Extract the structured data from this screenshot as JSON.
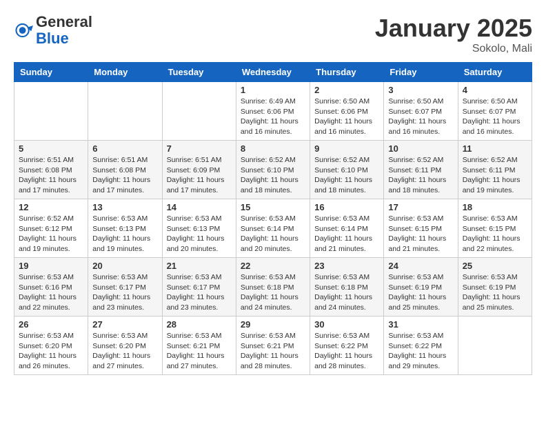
{
  "header": {
    "logo_general": "General",
    "logo_blue": "Blue",
    "month": "January 2025",
    "location": "Sokolo, Mali"
  },
  "days_of_week": [
    "Sunday",
    "Monday",
    "Tuesday",
    "Wednesday",
    "Thursday",
    "Friday",
    "Saturday"
  ],
  "weeks": [
    [
      {
        "day": "",
        "info": ""
      },
      {
        "day": "",
        "info": ""
      },
      {
        "day": "",
        "info": ""
      },
      {
        "day": "1",
        "info": "Sunrise: 6:49 AM\nSunset: 6:06 PM\nDaylight: 11 hours and 16 minutes."
      },
      {
        "day": "2",
        "info": "Sunrise: 6:50 AM\nSunset: 6:06 PM\nDaylight: 11 hours and 16 minutes."
      },
      {
        "day": "3",
        "info": "Sunrise: 6:50 AM\nSunset: 6:07 PM\nDaylight: 11 hours and 16 minutes."
      },
      {
        "day": "4",
        "info": "Sunrise: 6:50 AM\nSunset: 6:07 PM\nDaylight: 11 hours and 16 minutes."
      }
    ],
    [
      {
        "day": "5",
        "info": "Sunrise: 6:51 AM\nSunset: 6:08 PM\nDaylight: 11 hours and 17 minutes."
      },
      {
        "day": "6",
        "info": "Sunrise: 6:51 AM\nSunset: 6:08 PM\nDaylight: 11 hours and 17 minutes."
      },
      {
        "day": "7",
        "info": "Sunrise: 6:51 AM\nSunset: 6:09 PM\nDaylight: 11 hours and 17 minutes."
      },
      {
        "day": "8",
        "info": "Sunrise: 6:52 AM\nSunset: 6:10 PM\nDaylight: 11 hours and 18 minutes."
      },
      {
        "day": "9",
        "info": "Sunrise: 6:52 AM\nSunset: 6:10 PM\nDaylight: 11 hours and 18 minutes."
      },
      {
        "day": "10",
        "info": "Sunrise: 6:52 AM\nSunset: 6:11 PM\nDaylight: 11 hours and 18 minutes."
      },
      {
        "day": "11",
        "info": "Sunrise: 6:52 AM\nSunset: 6:11 PM\nDaylight: 11 hours and 19 minutes."
      }
    ],
    [
      {
        "day": "12",
        "info": "Sunrise: 6:52 AM\nSunset: 6:12 PM\nDaylight: 11 hours and 19 minutes."
      },
      {
        "day": "13",
        "info": "Sunrise: 6:53 AM\nSunset: 6:13 PM\nDaylight: 11 hours and 19 minutes."
      },
      {
        "day": "14",
        "info": "Sunrise: 6:53 AM\nSunset: 6:13 PM\nDaylight: 11 hours and 20 minutes."
      },
      {
        "day": "15",
        "info": "Sunrise: 6:53 AM\nSunset: 6:14 PM\nDaylight: 11 hours and 20 minutes."
      },
      {
        "day": "16",
        "info": "Sunrise: 6:53 AM\nSunset: 6:14 PM\nDaylight: 11 hours and 21 minutes."
      },
      {
        "day": "17",
        "info": "Sunrise: 6:53 AM\nSunset: 6:15 PM\nDaylight: 11 hours and 21 minutes."
      },
      {
        "day": "18",
        "info": "Sunrise: 6:53 AM\nSunset: 6:15 PM\nDaylight: 11 hours and 22 minutes."
      }
    ],
    [
      {
        "day": "19",
        "info": "Sunrise: 6:53 AM\nSunset: 6:16 PM\nDaylight: 11 hours and 22 minutes."
      },
      {
        "day": "20",
        "info": "Sunrise: 6:53 AM\nSunset: 6:17 PM\nDaylight: 11 hours and 23 minutes."
      },
      {
        "day": "21",
        "info": "Sunrise: 6:53 AM\nSunset: 6:17 PM\nDaylight: 11 hours and 23 minutes."
      },
      {
        "day": "22",
        "info": "Sunrise: 6:53 AM\nSunset: 6:18 PM\nDaylight: 11 hours and 24 minutes."
      },
      {
        "day": "23",
        "info": "Sunrise: 6:53 AM\nSunset: 6:18 PM\nDaylight: 11 hours and 24 minutes."
      },
      {
        "day": "24",
        "info": "Sunrise: 6:53 AM\nSunset: 6:19 PM\nDaylight: 11 hours and 25 minutes."
      },
      {
        "day": "25",
        "info": "Sunrise: 6:53 AM\nSunset: 6:19 PM\nDaylight: 11 hours and 25 minutes."
      }
    ],
    [
      {
        "day": "26",
        "info": "Sunrise: 6:53 AM\nSunset: 6:20 PM\nDaylight: 11 hours and 26 minutes."
      },
      {
        "day": "27",
        "info": "Sunrise: 6:53 AM\nSunset: 6:20 PM\nDaylight: 11 hours and 27 minutes."
      },
      {
        "day": "28",
        "info": "Sunrise: 6:53 AM\nSunset: 6:21 PM\nDaylight: 11 hours and 27 minutes."
      },
      {
        "day": "29",
        "info": "Sunrise: 6:53 AM\nSunset: 6:21 PM\nDaylight: 11 hours and 28 minutes."
      },
      {
        "day": "30",
        "info": "Sunrise: 6:53 AM\nSunset: 6:22 PM\nDaylight: 11 hours and 28 minutes."
      },
      {
        "day": "31",
        "info": "Sunrise: 6:53 AM\nSunset: 6:22 PM\nDaylight: 11 hours and 29 minutes."
      },
      {
        "day": "",
        "info": ""
      }
    ]
  ]
}
